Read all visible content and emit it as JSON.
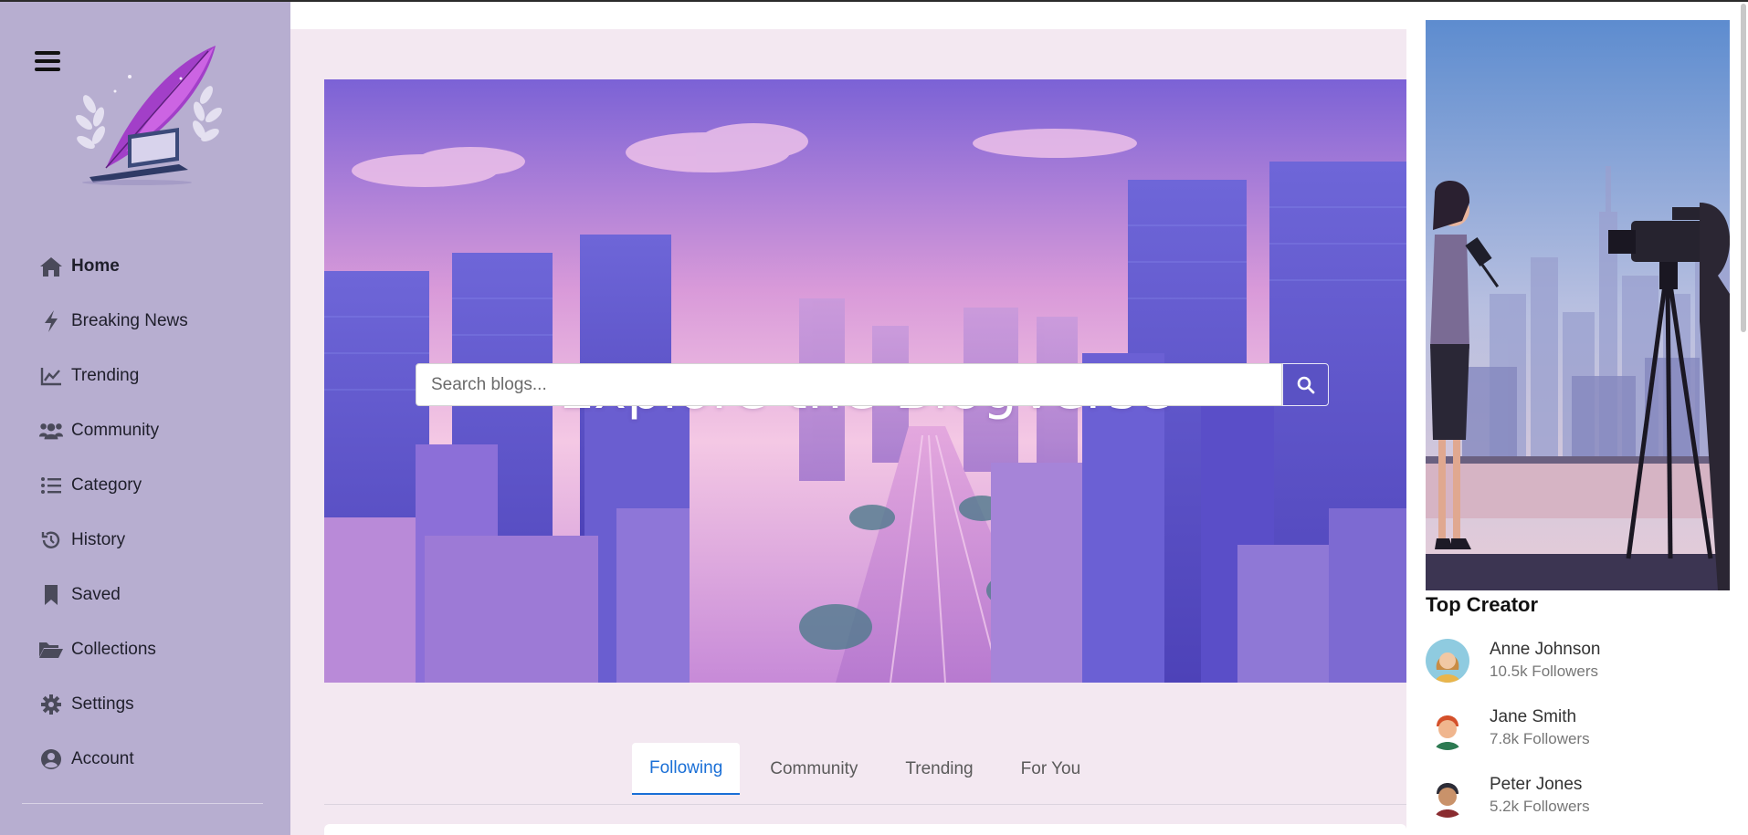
{
  "sidebar": {
    "items": [
      {
        "label": "Home",
        "icon": "home-icon"
      },
      {
        "label": "Breaking News",
        "icon": "bolt-icon"
      },
      {
        "label": "Trending",
        "icon": "chart-line-icon"
      },
      {
        "label": "Community",
        "icon": "users-icon"
      },
      {
        "label": "Category",
        "icon": "list-icon"
      },
      {
        "label": "History",
        "icon": "history-icon"
      },
      {
        "label": "Saved",
        "icon": "bookmark-icon"
      },
      {
        "label": "Collections",
        "icon": "folder-open-icon"
      },
      {
        "label": "Settings",
        "icon": "gear-icon"
      },
      {
        "label": "Account",
        "icon": "user-circle-icon"
      }
    ]
  },
  "hero": {
    "title": "Explore the BlogVerse",
    "search_placeholder": "Search blogs..."
  },
  "tabs": [
    "Following",
    "Community",
    "Trending",
    "For You"
  ],
  "right_panel": {
    "heading": "Top Creator",
    "creators": [
      {
        "name": "Anne Johnson",
        "followers": "10.5k Followers"
      },
      {
        "name": "Jane Smith",
        "followers": "7.8k Followers"
      },
      {
        "name": "Peter Jones",
        "followers": "5.2k Followers"
      }
    ]
  },
  "colors": {
    "sidebar_bg": "#b7aed0",
    "page_bg": "#f3e8f1",
    "accent": "#1a6fd6",
    "search_button": "#5a52c4"
  }
}
